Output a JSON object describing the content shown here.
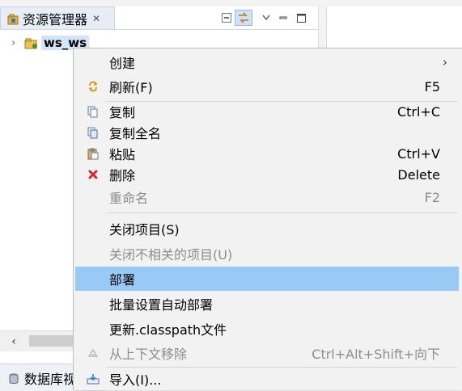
{
  "explorer": {
    "tab_title": "资源管理器",
    "tab_close": "✕",
    "tree_label": "ws_ws",
    "bottom_tab_title": "数据库视"
  },
  "menu": {
    "items": [
      {
        "label": "创建",
        "shortcut": "",
        "submenu": "›"
      },
      {
        "label": "刷新(F)",
        "shortcut": "F5"
      },
      {
        "label": "复制",
        "shortcut": "Ctrl+C"
      },
      {
        "label": "复制全名",
        "shortcut": ""
      },
      {
        "label": "粘贴",
        "shortcut": "Ctrl+V"
      },
      {
        "label": "删除",
        "shortcut": "Delete"
      },
      {
        "label": "重命名",
        "shortcut": "F2",
        "disabled": true
      },
      {
        "label": "关闭项目(S)",
        "shortcut": ""
      },
      {
        "label": "关闭不相关的项目(U)",
        "shortcut": "",
        "disabled": true
      },
      {
        "label": "部署",
        "shortcut": "",
        "highlighted": true
      },
      {
        "label": "批量设置自动部署",
        "shortcut": ""
      },
      {
        "label": "更新.classpath文件",
        "shortcut": ""
      },
      {
        "label": "从上下文移除",
        "shortcut": "Ctrl+Alt+Shift+向下",
        "disabled": true
      },
      {
        "label": "导入(I)...",
        "shortcut": ""
      }
    ]
  },
  "colors": {
    "highlight": "#99c9f5",
    "delete_icon": "#d9262b",
    "disabled_text": "#8d8d8d"
  }
}
